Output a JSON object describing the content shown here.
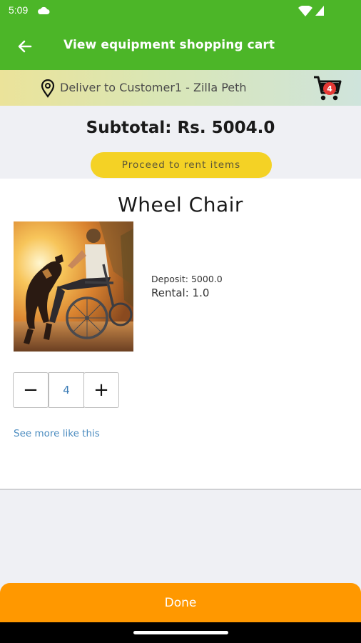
{
  "status_bar": {
    "time": "5:09"
  },
  "app_bar": {
    "title": "View equipment shopping cart"
  },
  "delivery": {
    "text": "Deliver to Customer1 - Zilla Peth"
  },
  "cart": {
    "count": "4"
  },
  "summary": {
    "subtotal": "Subtotal: Rs. 5004.0",
    "proceed_label": "Proceed to rent items"
  },
  "item": {
    "name": "Wheel Chair",
    "deposit": "Deposit: 5000.0",
    "rental": "Rental: 1.0",
    "quantity": "4",
    "decrement_symbol": "−",
    "increment_symbol": "+",
    "see_more": "See more like this"
  },
  "footer": {
    "done_label": "Done"
  },
  "colors": {
    "primary_green": "#4cb628",
    "proceed_yellow": "#f4d225",
    "done_orange": "#ff9800",
    "badge_red": "#e53935"
  }
}
